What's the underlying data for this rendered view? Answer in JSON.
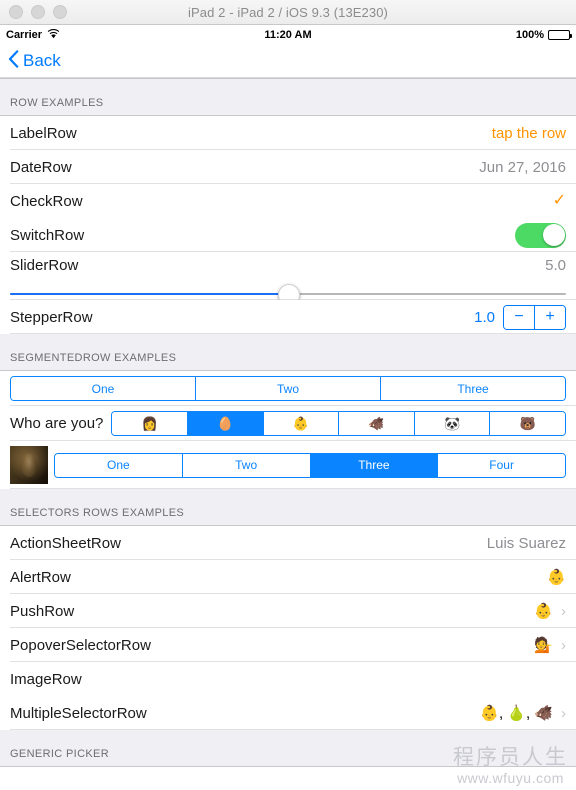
{
  "window": {
    "title": "iPad 2 - iPad 2 / iOS 9.3 (13E230)"
  },
  "status_bar": {
    "carrier": "Carrier",
    "wifi_icon": "wifi-icon",
    "time": "11:20 AM",
    "battery_percent": "100%",
    "battery_icon": "battery-icon"
  },
  "nav_bar": {
    "back_label": "Back",
    "back_icon": "chevron-left-icon"
  },
  "sections": {
    "row_examples": {
      "header": "ROW EXAMPLES",
      "rows": [
        {
          "title": "LabelRow",
          "value": "tap the row",
          "value_style": "accent"
        },
        {
          "title": "DateRow",
          "value": "Jun 27, 2016",
          "value_style": "muted"
        },
        {
          "title": "CheckRow",
          "value": "✓",
          "value_style": "check"
        },
        {
          "title": "SwitchRow",
          "switch_on": true
        },
        {
          "title": "SliderRow",
          "value": "5.0",
          "slider_value": 50
        },
        {
          "title": "StepperRow",
          "value": "1.0",
          "minus_label": "−",
          "plus_label": "+"
        }
      ]
    },
    "segmented_examples": {
      "header": "SEGMENTEDROW EXAMPLES",
      "plain_segments": {
        "options": [
          "One",
          "Two",
          "Three"
        ],
        "selected_index": -1
      },
      "emoji_segments": {
        "label": "Who are you?",
        "options": [
          "👩",
          "🥚",
          "👶",
          "🐗",
          "🐼",
          "🐻"
        ],
        "selected_index": 1
      },
      "image_segments": {
        "image_icon": "portrait-thumbnail",
        "options": [
          "One",
          "Two",
          "Three",
          "Four"
        ],
        "selected_index": 2
      }
    },
    "selectors_examples": {
      "header": "SELECTORS ROWS EXAMPLES",
      "rows": [
        {
          "title": "ActionSheetRow",
          "value": "Luis Suarez",
          "chevron": false
        },
        {
          "title": "AlertRow",
          "value": "👶",
          "chevron": false
        },
        {
          "title": "PushRow",
          "value": "👶",
          "chevron": true
        },
        {
          "title": "PopoverSelectorRow",
          "value": "💁",
          "chevron": true
        },
        {
          "title": "ImageRow",
          "value": "",
          "chevron": false
        },
        {
          "title": "MultipleSelectorRow",
          "value": "👶, 🍐, 🐗",
          "chevron": true
        }
      ]
    },
    "generic_picker": {
      "header": "GENERIC PICKER"
    }
  },
  "watermark": {
    "line1": "程序员人生",
    "line2": "www.wfuyu.com"
  },
  "colors": {
    "accent_orange": "#ff9500",
    "tint_blue": "#007aff",
    "segment_blue": "#0a84ff",
    "switch_green": "#4cd964",
    "slider_blue": "#1c6ff5",
    "section_bg": "#efeff4"
  }
}
